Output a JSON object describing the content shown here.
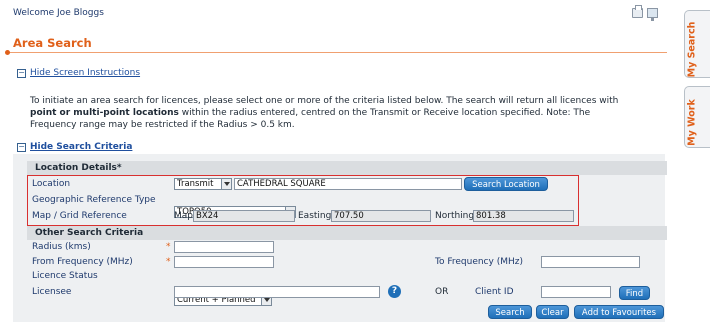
{
  "header": {
    "welcome": "Welcome Joe Bloggs",
    "title": "Area Search",
    "icons": [
      "print-icon",
      "screen-icon"
    ]
  },
  "instructions": {
    "toggle_label": "Hide Screen Instructions",
    "text_1": "To initiate an area search for licences, please select one or more of the criteria listed below. The search will return all licences with ",
    "bold_1": "point or multi-point locations",
    "text_2": " within the radius entered, centred on the Transmit or Receive location specified. Note: The Frequency range may be restricted if the Radius > 0.5 km."
  },
  "criteria": {
    "toggle_label": "Hide Search Criteria",
    "location_section": {
      "heading": "Location Details",
      "required_mark": "*",
      "location_label": "Location",
      "location_type": "Transmit",
      "location_value": "CATHEDRAL SQUARE",
      "search_location_button": "Search Location",
      "geo_ref_label": "Geographic Reference Type",
      "geo_ref_value": "TOPO50",
      "map_grid_label": "Map / Grid Reference",
      "map_label": "Map",
      "map_value": "BX24",
      "easting_label": "Easting",
      "easting_value": "707.50",
      "northing_label": "Northing",
      "northing_value": "801.38"
    },
    "other_section": {
      "heading": "Other Search Criteria",
      "radius_label": "Radius (kms)",
      "radius_value": "",
      "from_freq_label": "From Frequency (MHz)",
      "from_freq_value": "",
      "to_freq_label": "To Frequency (MHz)",
      "to_freq_value": "",
      "required_mark": "*",
      "licence_status_label": "Licence Status",
      "licence_status_value": "Current + Planned",
      "licensee_label": "Licensee",
      "licensee_value": "",
      "help_symbol": "?",
      "or_label": "OR",
      "client_id_label": "Client ID",
      "client_id_value": "",
      "find_button": "Find"
    },
    "actions": {
      "search_button": "Search",
      "clear_button": "Clear",
      "favourites_button": "Add to Favourites"
    }
  },
  "side_tabs": [
    "My Search",
    "My Work"
  ],
  "colors": {
    "accent": "#e0601a",
    "link": "#1f4f9e",
    "button": "#1f6fb8",
    "highlight_box": "#d83030"
  }
}
